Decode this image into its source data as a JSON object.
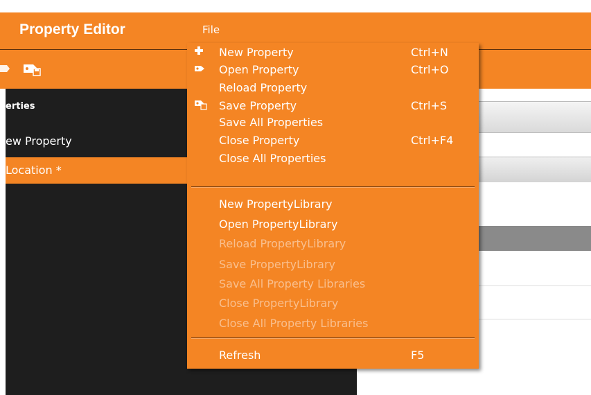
{
  "app": {
    "title": "Property Editor"
  },
  "menubar": {
    "file_label": "File"
  },
  "toolbar": {
    "icons": [
      "open-property-icon",
      "save-property-icon"
    ]
  },
  "sidebar": {
    "header": "erties",
    "items": [
      {
        "label": "ew Property",
        "selected": false
      },
      {
        "label": "Location *",
        "selected": true
      }
    ]
  },
  "file_menu": {
    "groups": [
      [
        {
          "label": "New Property",
          "shortcut": "Ctrl+N",
          "icon": "plus-icon",
          "enabled": true
        },
        {
          "label": "Open Property",
          "shortcut": "Ctrl+O",
          "icon": "open-tag-icon",
          "enabled": true
        },
        {
          "label": "Reload Property",
          "shortcut": "",
          "icon": "",
          "enabled": true
        },
        {
          "label": "Save Property",
          "shortcut": "Ctrl+S",
          "icon": "save-tag-icon",
          "enabled": true
        },
        {
          "label": "Save All Properties",
          "shortcut": "",
          "icon": "",
          "enabled": true
        },
        {
          "label": "Close Property",
          "shortcut": "Ctrl+F4",
          "icon": "",
          "enabled": true
        },
        {
          "label": "Close All Properties",
          "shortcut": "",
          "icon": "",
          "enabled": true
        }
      ],
      [
        {
          "label": "New PropertyLibrary",
          "shortcut": "",
          "enabled": true
        },
        {
          "label": "Open PropertyLibrary",
          "shortcut": "",
          "enabled": true
        },
        {
          "label": "Reload PropertyLibrary",
          "shortcut": "",
          "enabled": false
        },
        {
          "label": "Save PropertyLibrary",
          "shortcut": "",
          "enabled": false
        },
        {
          "label": "Save All Property Libraries",
          "shortcut": "",
          "enabled": false
        },
        {
          "label": "Close PropertyLibrary",
          "shortcut": "",
          "enabled": false
        },
        {
          "label": "Close All Property Libraries",
          "shortcut": "",
          "enabled": false
        }
      ],
      [
        {
          "label": "Refresh",
          "shortcut": "F5",
          "enabled": true
        }
      ]
    ]
  },
  "colors": {
    "accent": "#f48524",
    "panel_dark": "#1e1e1e",
    "menu_text": "#ffffff",
    "menu_text_disabled": "#f9bf8e",
    "row_gray": "#8a8a8a"
  }
}
